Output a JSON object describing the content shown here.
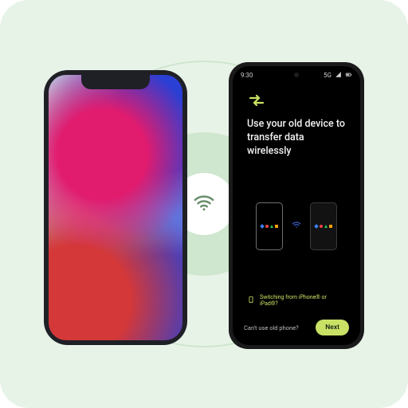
{
  "accent": "#c9e265",
  "statusbar": {
    "time": "9:30",
    "network_label": "5G"
  },
  "setup": {
    "headline": "Use your old device to transfer data wirelessly",
    "switching_hint": "Switching from iPhone® or iPad®?",
    "cant_use_label": "Can't use old phone?",
    "next_label": "Next"
  },
  "icons": {
    "hub": "wifi",
    "mini_wifi": "wifi",
    "signal": "signal-cellular",
    "battery": "battery",
    "setup": "arrows-transfer",
    "switch_device": "phone-iphone"
  },
  "phones": {
    "left": {
      "role": "old-device",
      "platform": "ios"
    },
    "right": {
      "role": "new-device",
      "platform": "android-pixel"
    }
  }
}
